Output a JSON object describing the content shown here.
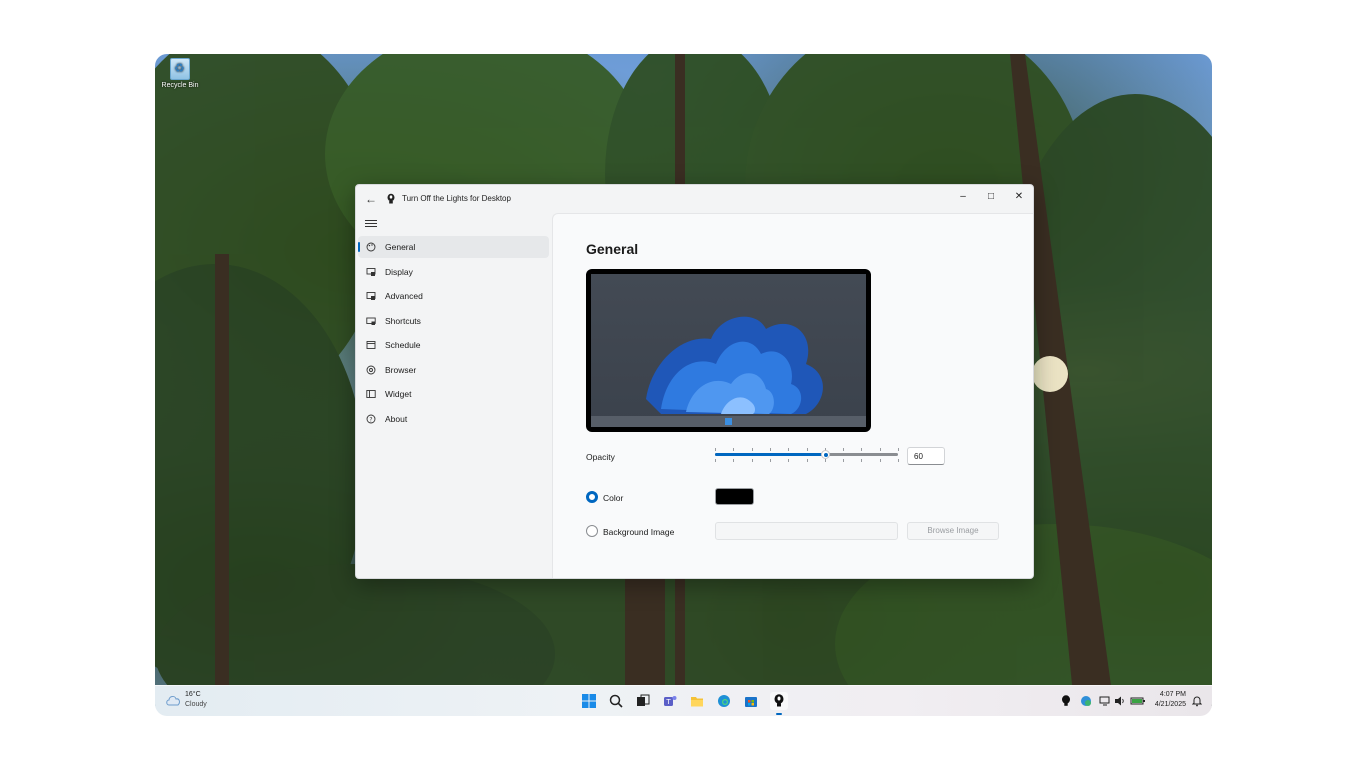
{
  "desktop": {
    "recycle_bin_label": "Recycle Bin"
  },
  "window": {
    "title": "Turn Off the Lights for Desktop",
    "controls": {
      "minimize": "–",
      "maximize": "□",
      "close": "✕"
    }
  },
  "nav": {
    "items": [
      {
        "label": "General",
        "icon": "palette-icon",
        "active": true
      },
      {
        "label": "Display",
        "icon": "display-icon"
      },
      {
        "label": "Advanced",
        "icon": "advanced-icon"
      },
      {
        "label": "Shortcuts",
        "icon": "keyboard-icon"
      },
      {
        "label": "Schedule",
        "icon": "calendar-icon"
      },
      {
        "label": "Browser",
        "icon": "browser-icon"
      },
      {
        "label": "Widget",
        "icon": "widget-icon"
      },
      {
        "label": "About",
        "icon": "help-icon"
      }
    ]
  },
  "general": {
    "title": "General",
    "opacity_label": "Opacity",
    "opacity_value": "60",
    "opacity_fraction": 0.6,
    "color_label": "Color",
    "color_value": "#000000",
    "bg_image_label": "Background Image",
    "bg_image_placeholder": "",
    "browse_label": "Browse Image",
    "selected_mode": "color"
  },
  "taskbar": {
    "weather_temp": "16°C",
    "weather_condition": "Cloudy",
    "time": "4:07 PM",
    "date": "4/21/2025",
    "apps": [
      "start-icon",
      "search-icon",
      "task-view-icon",
      "teams-icon",
      "file-explorer-icon",
      "edge-icon",
      "store-icon",
      "turn-off-the-lights-icon"
    ],
    "tray": [
      "lamp-tray-icon",
      "defender-tray-icon",
      "network-icon",
      "volume-icon",
      "battery-icon"
    ]
  },
  "colors": {
    "accent": "#0067c0"
  }
}
